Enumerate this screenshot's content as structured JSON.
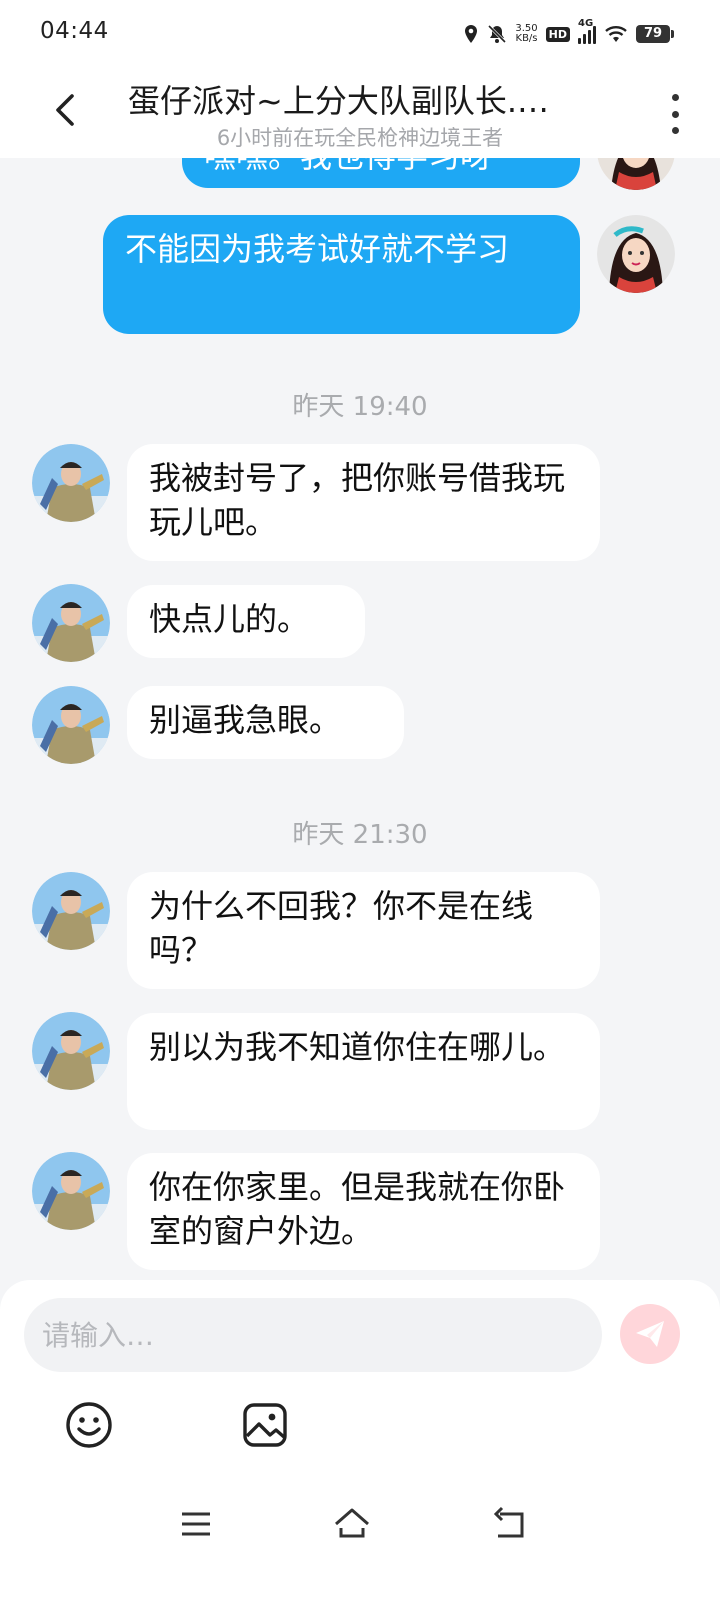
{
  "status_bar": {
    "time": "04:44",
    "net_speed_value": "3.50",
    "net_speed_unit": "KB/s",
    "hd_label": "HD",
    "network_label": "4G",
    "battery_level": "79",
    "icons": [
      "location-icon",
      "mute-bell-icon",
      "signal-icon",
      "wifi-icon",
      "battery-icon"
    ]
  },
  "header": {
    "title": "蛋仔派对~上分大队副队长.…",
    "subtitle": "6小时前在玩全民枪神边境王者"
  },
  "messages": [
    {
      "type": "out",
      "text": "嘿嘿。我也得学习呀"
    },
    {
      "type": "out",
      "text": "不能因为我考试好就不学习"
    },
    {
      "type": "timestamp",
      "text": "昨天 19:40"
    },
    {
      "type": "in",
      "text": "我被封号了，把你账号借我玩玩儿吧。"
    },
    {
      "type": "in",
      "text": "快点儿的。"
    },
    {
      "type": "in",
      "text": "别逼我急眼。"
    },
    {
      "type": "timestamp",
      "text": "昨天 21:30"
    },
    {
      "type": "in",
      "text": "为什么不回我？你不是在线吗？"
    },
    {
      "type": "in",
      "text": "别以为我不知道你住在哪儿。"
    },
    {
      "type": "in",
      "text": "你在你家里。但是我就在你卧室的窗户外边。"
    }
  ],
  "input": {
    "placeholder": "请输入…",
    "value": ""
  },
  "colors": {
    "outgoing_bubble": "#1ea8f4",
    "incoming_bubble": "#ffffff",
    "background": "#f4f5f7",
    "send_button": "#ffd6da"
  }
}
